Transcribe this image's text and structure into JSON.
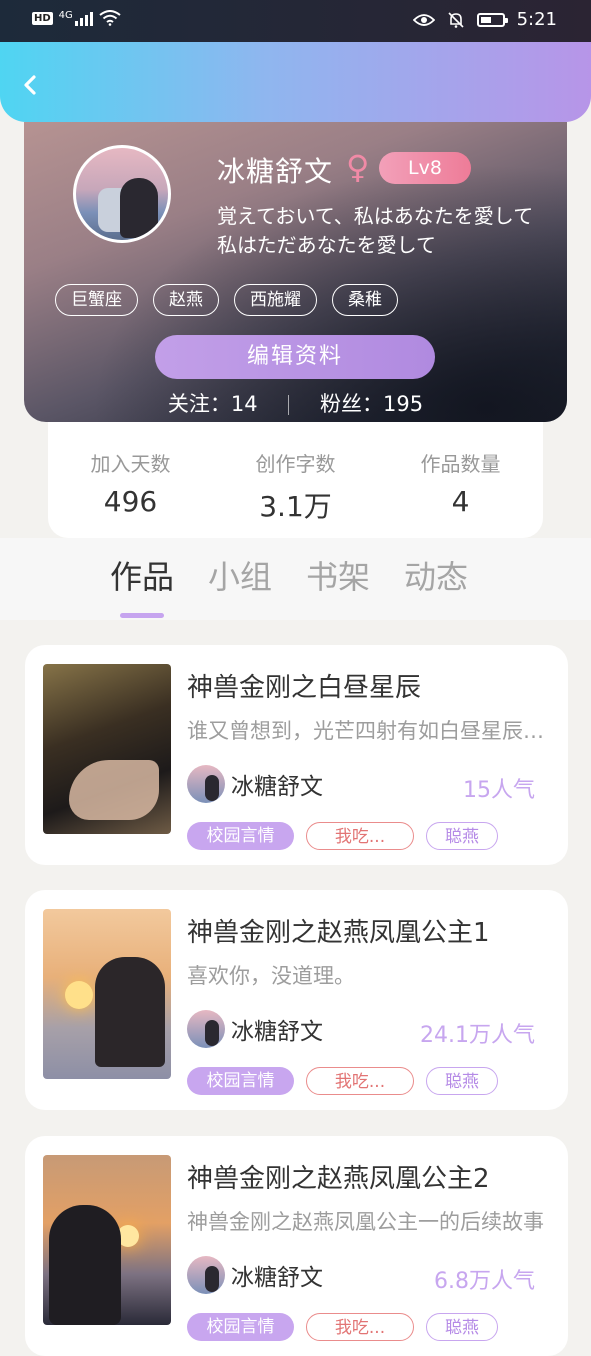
{
  "status_bar": {
    "hd": "HD",
    "net": "4G",
    "time": "5:21"
  },
  "profile": {
    "username": "冰糖舒文",
    "gender_symbol": "♀",
    "level": "Lv8",
    "bio_line1": "覚えておいて、私はあなたを愛して",
    "bio_line2": "私はただあなたを愛して",
    "tags": [
      "巨蟹座",
      "赵燕",
      "西施耀",
      "桑稚"
    ],
    "edit_label": "编辑资料",
    "following_label": "关注：",
    "following": "14",
    "followers_label": "粉丝：",
    "followers": "195"
  },
  "stats": [
    {
      "label": "加入天数",
      "value": "496"
    },
    {
      "label": "创作字数",
      "value": "3.1万"
    },
    {
      "label": "作品数量",
      "value": "4"
    }
  ],
  "tabs": [
    "作品",
    "小组",
    "书架",
    "动态"
  ],
  "works": [
    {
      "title": "神兽金刚之白昼星辰",
      "desc": "谁又曾想到，光芒四射有如白昼星辰的少年",
      "author": "冰糖舒文",
      "popularity": "15人气",
      "tags": [
        "校园言情",
        "我吃...",
        "聪燕"
      ]
    },
    {
      "title": "神兽金刚之赵燕凤凰公主1",
      "desc": "喜欢你，没道理。",
      "author": "冰糖舒文",
      "popularity": "24.1万人气",
      "tags": [
        "校园言情",
        "我吃...",
        "聪燕"
      ]
    },
    {
      "title": "神兽金刚之赵燕凤凰公主2",
      "desc": "神兽金刚之赵燕凤凰公主一的后续故事",
      "author": "冰糖舒文",
      "popularity": "6.8万人气",
      "tags": [
        "校园言情",
        "我吃...",
        "聪燕"
      ]
    }
  ],
  "colors": {
    "accent": "#c6a4ef",
    "header_start": "#4fd5f2",
    "header_end": "#b795e8",
    "level_badge": "#ee7c98"
  }
}
